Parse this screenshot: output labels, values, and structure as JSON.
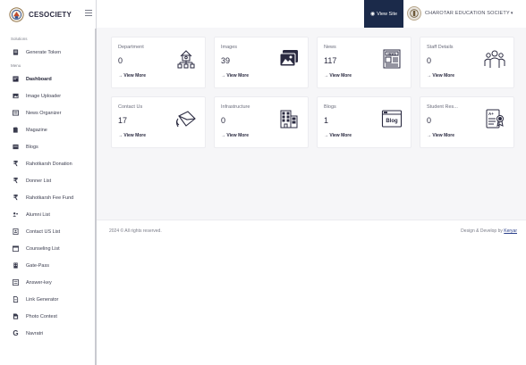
{
  "brand": {
    "name": "CESOCIETY"
  },
  "sidebar": {
    "section_solutions": "Solutions",
    "solutions_items": [
      {
        "label": "Generate Token",
        "icon": "document-icon"
      }
    ],
    "section_menu": "Menu",
    "items": [
      {
        "label": "Dashboard",
        "icon": "dashboard-icon",
        "active": true
      },
      {
        "label": "Image Uploader",
        "icon": "image-icon"
      },
      {
        "label": "News Organizer",
        "icon": "news-icon"
      },
      {
        "label": "Magazine",
        "icon": "book-icon"
      },
      {
        "label": "Blogs",
        "icon": "blog-icon"
      },
      {
        "label": "Rahotkarsh Donation",
        "icon": "rupee-icon"
      },
      {
        "label": "Donner List",
        "icon": "rupee-icon"
      },
      {
        "label": "Rahotkarsh Fee Fund",
        "icon": "rupee-icon"
      },
      {
        "label": "Alumni List",
        "icon": "users-icon"
      },
      {
        "label": "Contact US List",
        "icon": "contact-icon"
      },
      {
        "label": "Counseling List",
        "icon": "calendar-icon"
      },
      {
        "label": "Gate-Pass",
        "icon": "building-icon"
      },
      {
        "label": "Answer-key",
        "icon": "list-icon"
      },
      {
        "label": "Link Generator",
        "icon": "link-icon"
      },
      {
        "label": "Photo Contest",
        "icon": "photo-icon"
      },
      {
        "label": "Navratri",
        "icon": "google-icon"
      }
    ]
  },
  "header": {
    "view_site": "View Site",
    "org_name": "CHAROTAR EDUCATION SOCIETY"
  },
  "cards": [
    {
      "title": "Department",
      "count": "0",
      "more": "→ View More",
      "icon": "department-icon"
    },
    {
      "title": "Images",
      "count": "39",
      "more": "→ View More",
      "icon": "images-icon"
    },
    {
      "title": "News",
      "count": "117",
      "more": "→ View More",
      "icon": "newspaper-icon"
    },
    {
      "title": "Staff Details",
      "count": "0",
      "more": "→ View More",
      "icon": "staff-icon"
    },
    {
      "title": "Contact Us",
      "count": "17",
      "more": "→ View More",
      "icon": "envelope-icon"
    },
    {
      "title": "Infrastructure",
      "count": "0",
      "more": "→ View More",
      "icon": "infrastructure-icon"
    },
    {
      "title": "Blogs",
      "count": "1",
      "more": "→ View More",
      "icon": "blog-window-icon"
    },
    {
      "title": "Student Res...",
      "count": "0",
      "more": "→ View More",
      "icon": "result-icon"
    }
  ],
  "footer": {
    "copyright": "2024 © All rights reserved.",
    "credit_prefix": "Design & Develop by ",
    "credit_link": "Keryar"
  },
  "colors": {
    "accent": "#1b2a4a",
    "background": "#f6f6f8",
    "link": "#2a3f8a"
  }
}
